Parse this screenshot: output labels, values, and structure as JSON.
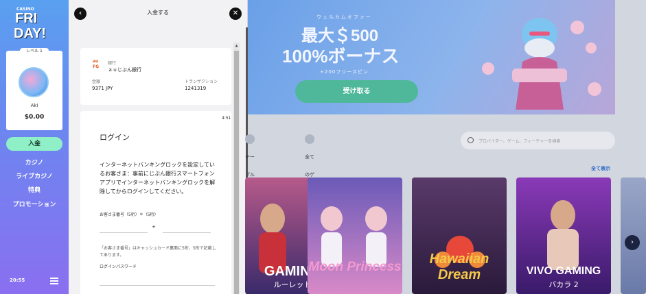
{
  "sidebar": {
    "logo_casino": "CASINO",
    "logo_fri": "FRI",
    "logo_day": "DAY!",
    "level": "レベル 1",
    "username": "Aki",
    "balance": "$0.00",
    "deposit_label": "入金",
    "nav": [
      "カジノ",
      "ライブカジノ",
      "特典",
      "プロモーション"
    ],
    "time": "20:55"
  },
  "deposit_panel": {
    "title": "入金する",
    "bank": {
      "logo": "au FG",
      "sub_label": "銀行",
      "name": "ａｕじぶん銀行",
      "amount_label": "金額",
      "amount_value": "9371 JPY",
      "transaction_label": "トランザクション",
      "transaction_value": "1241319"
    },
    "login": {
      "clock": "4:51",
      "title": "ログイン",
      "message": "インターネットバンキングロックを設定しているお客さま：事前にじぶん銀行スマートフォンアプリでインターネットバンキングロックを解除してからログインしてください。",
      "customer_number_label": "お客さま番号（5桁）＊（5桁）",
      "plus": "+",
      "note": "「お客さま番号」はキャッシュカード裏面に5桁、5桁で記載してあります。",
      "password_label": "ログインパスワード"
    }
  },
  "casino": {
    "banner": {
      "subtitle": "ウェルカムオファー",
      "line1": "最大＄500",
      "line2": "100%ボーナス",
      "line3": "+200フリースピン",
      "cta": "受け取る"
    },
    "tabs": [
      "テーブルゲーム",
      "全てのゲーム"
    ],
    "search_placeholder": "プロバイダー、ゲーム、フィーチャーを検索",
    "show_all": "全て表示",
    "games": [
      {
        "title": "GAMING",
        "subtitle": "ルーレット"
      },
      {
        "title": "Moon Princess",
        "subtitle": ""
      },
      {
        "title": "Hawaiian Dream",
        "subtitle": ""
      },
      {
        "title": "VIVO GAMING",
        "subtitle": "バカラ 2"
      }
    ],
    "next_label": "›"
  }
}
